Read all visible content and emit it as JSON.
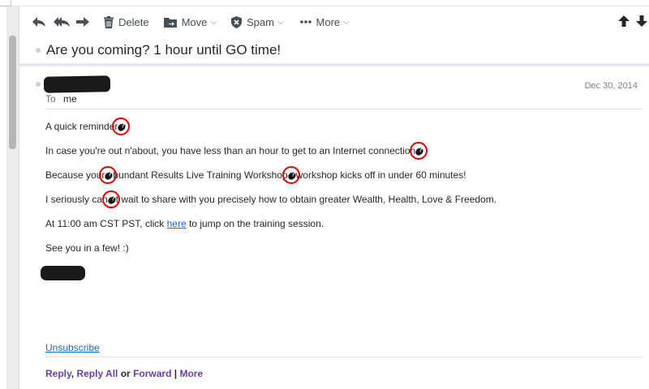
{
  "toolbar": {
    "delete_label": "Delete",
    "move_label": "Move",
    "spam_label": "Spam",
    "more_label": "More",
    "caret": "⌵"
  },
  "message": {
    "subject": "Are you coming? 1 hour until GO time!",
    "date": "Dec 30, 2014",
    "to_label": "To",
    "to_value": "me",
    "lines": {
      "l1": "A quick reminder",
      "l2": "In case you're out n'about, you have less than an hour to get to an Internet connection",
      "l3a": "Because your",
      "l3b": "bundant Results Live Training Workshop",
      "l3c": "workshop kicks off in under 60 minutes!",
      "l4a": "I seriously can",
      "l4b": "t wait to share with you precisely how to obtain greater Wealth, Health, Love & Freedom.",
      "l5a": "At 11:00 am CST PST, click ",
      "l5link": "here",
      "l5b": " to jump on the training session.",
      "l6": "See you in a few! :)"
    },
    "unsubscribe": "Unsubscribe"
  },
  "actions": {
    "reply": "Reply",
    "reply_all": "Reply All",
    "or": "or",
    "forward": "Forward",
    "divider": "|",
    "more": "More"
  },
  "icons": [
    "reply-icon",
    "reply-all-icon",
    "forward-icon",
    "trash-icon",
    "folder-icon",
    "shield-icon",
    "ellipsis-icon",
    "arrow-up-icon",
    "arrow-down-icon"
  ],
  "colors": {
    "link": "#0f69ff",
    "action_purple": "#6b3fa0",
    "highlight_ring": "#e00000",
    "redaction": "#1c1a18"
  }
}
